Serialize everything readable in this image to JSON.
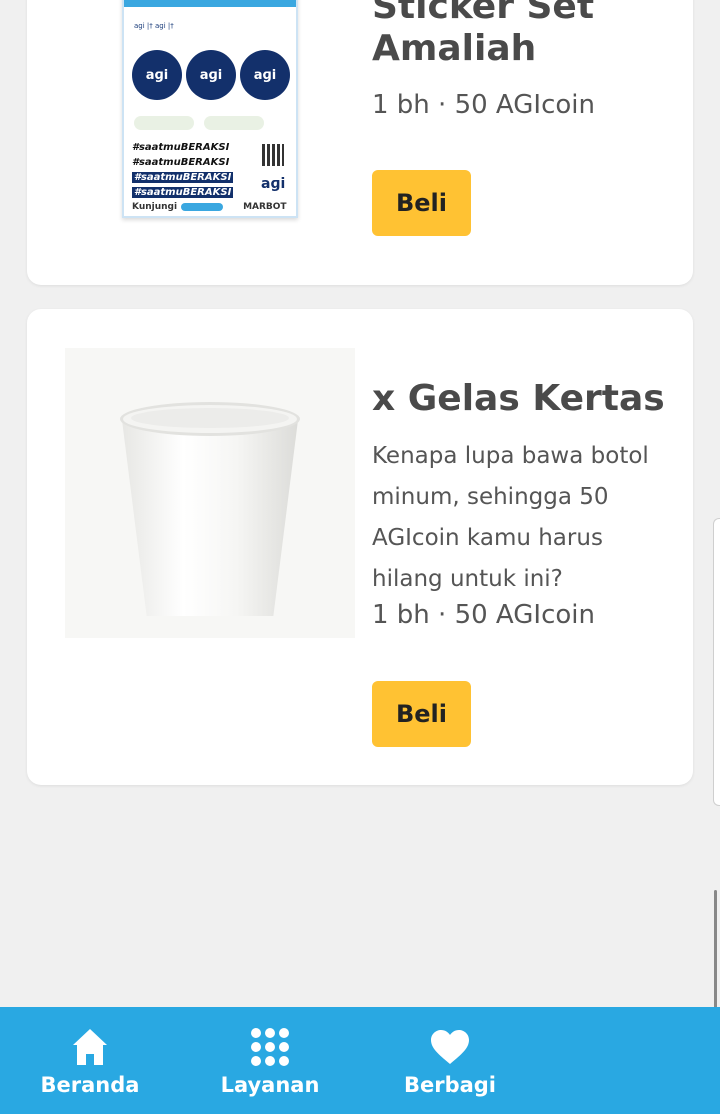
{
  "products": [
    {
      "title": "Sticker Set Amaliah",
      "price": "1 bh · 50 AGIcoin",
      "buy_label": "Beli",
      "image": {
        "sheet_text": "aɡi |† aɡi |†",
        "circle_label": "aɡi",
        "hashtag": "#saatmuBERAKSI",
        "logo": "aɡi",
        "footer_left": "Kunjungi",
        "footer_right": "MARBOT"
      }
    },
    {
      "title": "x Gelas Kertas",
      "description": "Kenapa lupa bawa botol minum, sehingga 50 AGIcoin kamu harus hilang untuk ini?",
      "price": "1 bh · 50 AGIcoin",
      "buy_label": "Beli"
    }
  ],
  "bottom_nav": [
    {
      "label": "Beranda",
      "icon": "home-icon"
    },
    {
      "label": "Layanan",
      "icon": "grid-icon"
    },
    {
      "label": "Berbagi",
      "icon": "heart-icon"
    }
  ],
  "colors": {
    "nav_background": "#29a8e2",
    "buy_button": "#ffc233",
    "page_background": "#f0f0f0"
  }
}
